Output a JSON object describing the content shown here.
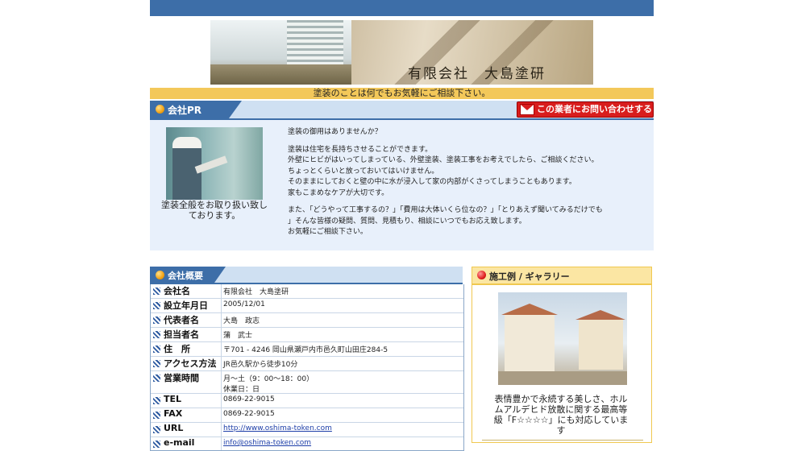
{
  "site": {
    "company_name": "有限会社　大島塗研",
    "tagline": "塗装のことは何でもお気軽にご相談下さい。"
  },
  "pr_section": {
    "title": "会社PR",
    "contact_button": "この業者にお問い合わせする",
    "photo_caption": "塗装全般をお取り扱い致しております。",
    "lines": [
      "塗装の御用はありませんか？",
      "",
      "塗装は住宅を長持ちさせることができます。",
      "外壁にヒビがはいってしまっている、外壁塗装、塗装工事をお考えでしたら、ご相談ください。",
      "ちょっとくらいと放っておいてはいけません。",
      "そのままにしておくと壁の中に水が浸入して家の内部がくさってしまうこともあります。",
      "家もこまめなケアが大切です。",
      "",
      "また、「どうやって工事するの？」「費用は大体いくら位なの？」「とりあえず聞いてみるだけでも",
      "」そんな皆様の疑問、質問、見積もり、相談にいつでもお応え致します。",
      "お気軽にご相談下さい。"
    ]
  },
  "company_info": {
    "title": "会社概要",
    "rows": [
      {
        "key": "会社名",
        "value": "有限会社　大島塗研"
      },
      {
        "key": "設立年月日",
        "value": "2005/12/01"
      },
      {
        "key": "代表者名",
        "value": "大島　政志"
      },
      {
        "key": "担当者名",
        "value": "蒲　武士"
      },
      {
        "key": "住　所",
        "value": "〒701 - 4246 岡山県瀬戸内市邑久町山田庄284-5"
      },
      {
        "key": "アクセス方法",
        "value": "JR邑久駅から徒歩10分"
      },
      {
        "key": "営業時間",
        "value": "月～土（9：00～18：00）",
        "value2": "休業日：日"
      },
      {
        "key": "TEL",
        "value": "0869-22-9015"
      },
      {
        "key": "FAX",
        "value": "0869-22-9015"
      },
      {
        "key": "URL",
        "value": "http://www.oshima-token.com",
        "link": true
      },
      {
        "key": "e-mail",
        "value": "info@oshima-token.com",
        "link": true
      }
    ]
  },
  "gallery": {
    "title": "施工例 / ギャラリー",
    "caption": "表情豊かで永続する美しさ、ホルムアルデヒド放散に関する最高等級「F☆☆☆☆」にも対応しています"
  },
  "colors": {
    "header_blue": "#3d6ea8",
    "tagline_yellow": "#f3c85a",
    "button_red": "#d81d1d",
    "panel_blue": "#e8f0fb"
  }
}
